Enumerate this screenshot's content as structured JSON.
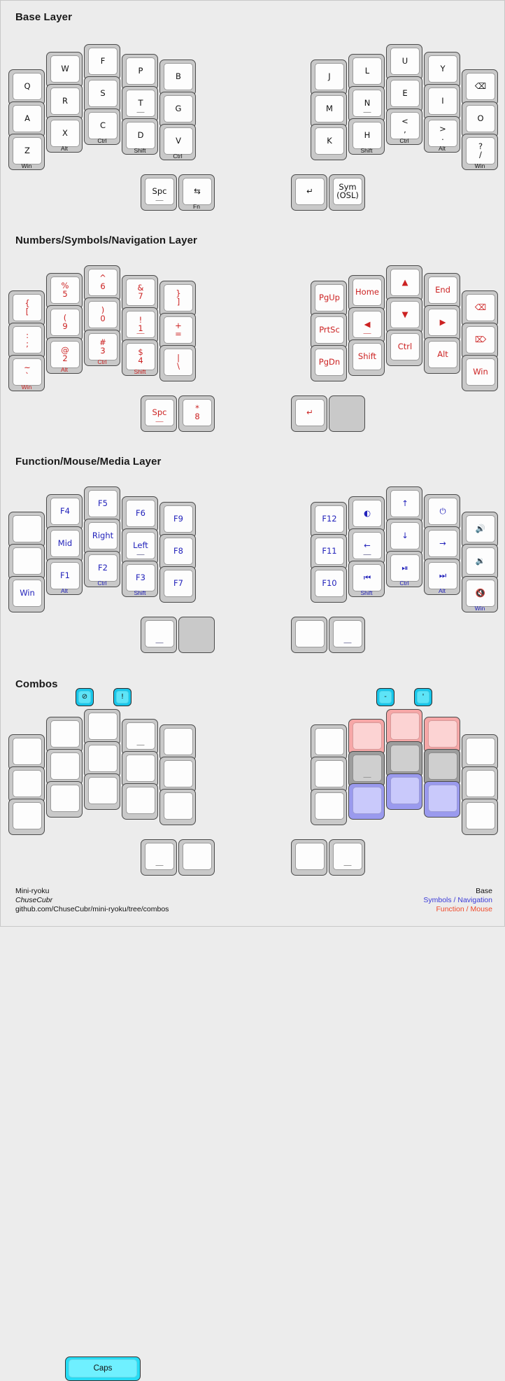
{
  "sections": {
    "base": "Base Layer",
    "nav": "Numbers/Symbols/Navigation Layer",
    "fn": "Function/Mouse/Media Layer",
    "combos": "Combos"
  },
  "footer": {
    "name": "Mini-ryoku",
    "author": "ChuseCubr",
    "url": "github.com/ChuseCubr/mini-ryoku/tree/combos"
  },
  "legend": {
    "base": "Base",
    "symbols": "Symbols / Navigation",
    "function": "Function / Mouse"
  },
  "colors": {
    "base": "#111111",
    "symbols": "#cc2222",
    "function": "#2222bb",
    "legend_symbols": "#3a3ad8",
    "legend_function": "#f04a2a",
    "combo": "#27dcf4",
    "combo_pink": "#f6a7a7",
    "combo_gray": "#9d9d9d",
    "combo_blue": "#9a9aee",
    "background": "#ececec",
    "key_body": "#c9c9c9",
    "key_cap": "#fdfdfd"
  },
  "layers": {
    "base": {
      "left": [
        {
          "main": "Q"
        },
        {
          "main": "A"
        },
        {
          "main": "Z",
          "sub": "Win"
        },
        {
          "main": "W"
        },
        {
          "main": "R"
        },
        {
          "main": "X",
          "sub": "Alt"
        },
        {
          "main": "F"
        },
        {
          "main": "S"
        },
        {
          "main": "C",
          "sub": "Ctrl"
        },
        {
          "main": "P"
        },
        {
          "main": "T",
          "hold": true
        },
        {
          "main": "D",
          "sub": "Shift"
        },
        {
          "main": "B"
        },
        {
          "main": "G"
        },
        {
          "main": "V",
          "sub": "Ctrl"
        }
      ],
      "left_thumbs": [
        {
          "main": "Spc",
          "hold": true
        },
        {
          "main": "⇆",
          "sub": "Fn"
        }
      ],
      "right": [
        {
          "main": "J"
        },
        {
          "main": "M"
        },
        {
          "main": "K"
        },
        {
          "main": "L"
        },
        {
          "main": "N",
          "hold": true
        },
        {
          "main": "H",
          "sub": "Shift"
        },
        {
          "main": "U"
        },
        {
          "main": "E"
        },
        {
          "main": "<\n,",
          "sub": "Ctrl"
        },
        {
          "main": "Y"
        },
        {
          "main": "I"
        },
        {
          "main": ">\n.",
          "sub": "Alt"
        },
        {
          "main": "⌫"
        },
        {
          "main": "O"
        },
        {
          "main": "?\n/",
          "sub": "Win"
        }
      ],
      "right_thumbs": [
        {
          "main": "↵"
        },
        {
          "main": "Sym\n(OSL)"
        }
      ]
    },
    "nav": {
      "left": [
        {
          "main": "{\n["
        },
        {
          "main": ":\n;"
        },
        {
          "main": "~\n`",
          "sub": "Win"
        },
        {
          "main": "%\n5"
        },
        {
          "main": "(\n9"
        },
        {
          "main": "@\n2",
          "sub": "Alt"
        },
        {
          "main": "^\n6"
        },
        {
          "main": ")\n0"
        },
        {
          "main": "#\n3",
          "sub": "Ctrl"
        },
        {
          "main": "&\n7"
        },
        {
          "main": "!\n1",
          "hold": true
        },
        {
          "main": "$\n4",
          "sub": "Shift"
        },
        {
          "main": "}\n]"
        },
        {
          "main": "+\n="
        },
        {
          "main": "|\n\\"
        }
      ],
      "left_thumbs": [
        {
          "main": "Spc",
          "hold": true
        },
        {
          "main": "*\n8"
        }
      ],
      "right": [
        {
          "main": "PgUp"
        },
        {
          "main": "PrtSc"
        },
        {
          "main": "PgDn"
        },
        {
          "main": "Home"
        },
        {
          "main": "◀",
          "hold": true
        },
        {
          "main": "Shift"
        },
        {
          "main": "▲"
        },
        {
          "main": "▼"
        },
        {
          "main": "Ctrl"
        },
        {
          "main": "End"
        },
        {
          "main": "▶"
        },
        {
          "main": "Alt"
        },
        {
          "main": "⌫"
        },
        {
          "main": "⌦"
        },
        {
          "main": "Win"
        }
      ],
      "right_thumbs": [
        {
          "main": "↵"
        },
        {
          "trans": true
        }
      ]
    },
    "fn": {
      "left": [
        {
          "main": ""
        },
        {
          "main": ""
        },
        {
          "main": "Win"
        },
        {
          "main": "F4"
        },
        {
          "main": "Mid"
        },
        {
          "main": "F1",
          "sub": "Alt"
        },
        {
          "main": "F5"
        },
        {
          "main": "Right"
        },
        {
          "main": "F2",
          "sub": "Ctrl"
        },
        {
          "main": "F6"
        },
        {
          "main": "Left",
          "hold": true
        },
        {
          "main": "F3",
          "sub": "Shift"
        },
        {
          "main": "F9"
        },
        {
          "main": "F8"
        },
        {
          "main": "F7"
        }
      ],
      "left_thumbs": [
        {
          "main": "",
          "hold": true
        },
        {
          "trans": true
        }
      ],
      "right": [
        {
          "main": "F12"
        },
        {
          "main": "F11"
        },
        {
          "main": "F10"
        },
        {
          "main": "◐"
        },
        {
          "main": "←",
          "hold": true
        },
        {
          "main": "⏮",
          "sub": "Shift"
        },
        {
          "main": "↑"
        },
        {
          "main": "↓"
        },
        {
          "main": "⏯",
          "sub": "Ctrl"
        },
        {
          "main": "⏻"
        },
        {
          "main": "→"
        },
        {
          "main": "⏭",
          "sub": "Alt"
        },
        {
          "main": "🔊"
        },
        {
          "main": "🔉"
        },
        {
          "main": "🔇",
          "sub": "Win"
        }
      ],
      "right_thumbs": [
        {
          "main": ""
        },
        {
          "main": "",
          "hold": true
        }
      ]
    },
    "combos": {
      "left": [
        {
          "main": ""
        },
        {
          "main": ""
        },
        {
          "main": ""
        },
        {
          "main": ""
        },
        {
          "main": ""
        },
        {
          "main": ""
        },
        {
          "main": ""
        },
        {
          "main": ""
        },
        {
          "main": ""
        },
        {
          "main": "",
          "hold": true
        },
        {
          "main": ""
        },
        {
          "main": ""
        },
        {
          "main": ""
        },
        {
          "main": ""
        },
        {
          "main": ""
        }
      ],
      "left_thumbs": [
        {
          "main": "",
          "hold": true
        },
        {
          "main": ""
        }
      ],
      "right": [
        {
          "main": ""
        },
        {
          "main": ""
        },
        {
          "main": ""
        },
        {
          "main": "",
          "hl": "pink"
        },
        {
          "main": "",
          "hl": "gray",
          "hold": true
        },
        {
          "main": "",
          "hl": "blue"
        },
        {
          "main": "",
          "hl": "pink"
        },
        {
          "main": "",
          "hl": "gray"
        },
        {
          "main": "",
          "hl": "blue"
        },
        {
          "main": "",
          "hl": "pink"
        },
        {
          "main": "",
          "hl": "gray"
        },
        {
          "main": "",
          "hl": "blue"
        },
        {
          "main": ""
        },
        {
          "main": ""
        },
        {
          "main": ""
        }
      ],
      "right_thumbs": [
        {
          "main": ""
        },
        {
          "main": "",
          "hold": true
        }
      ],
      "caps_bar": "Caps",
      "badges_left": [
        "⊘",
        "!"
      ],
      "badges_right": [
        "-",
        "'"
      ]
    }
  }
}
